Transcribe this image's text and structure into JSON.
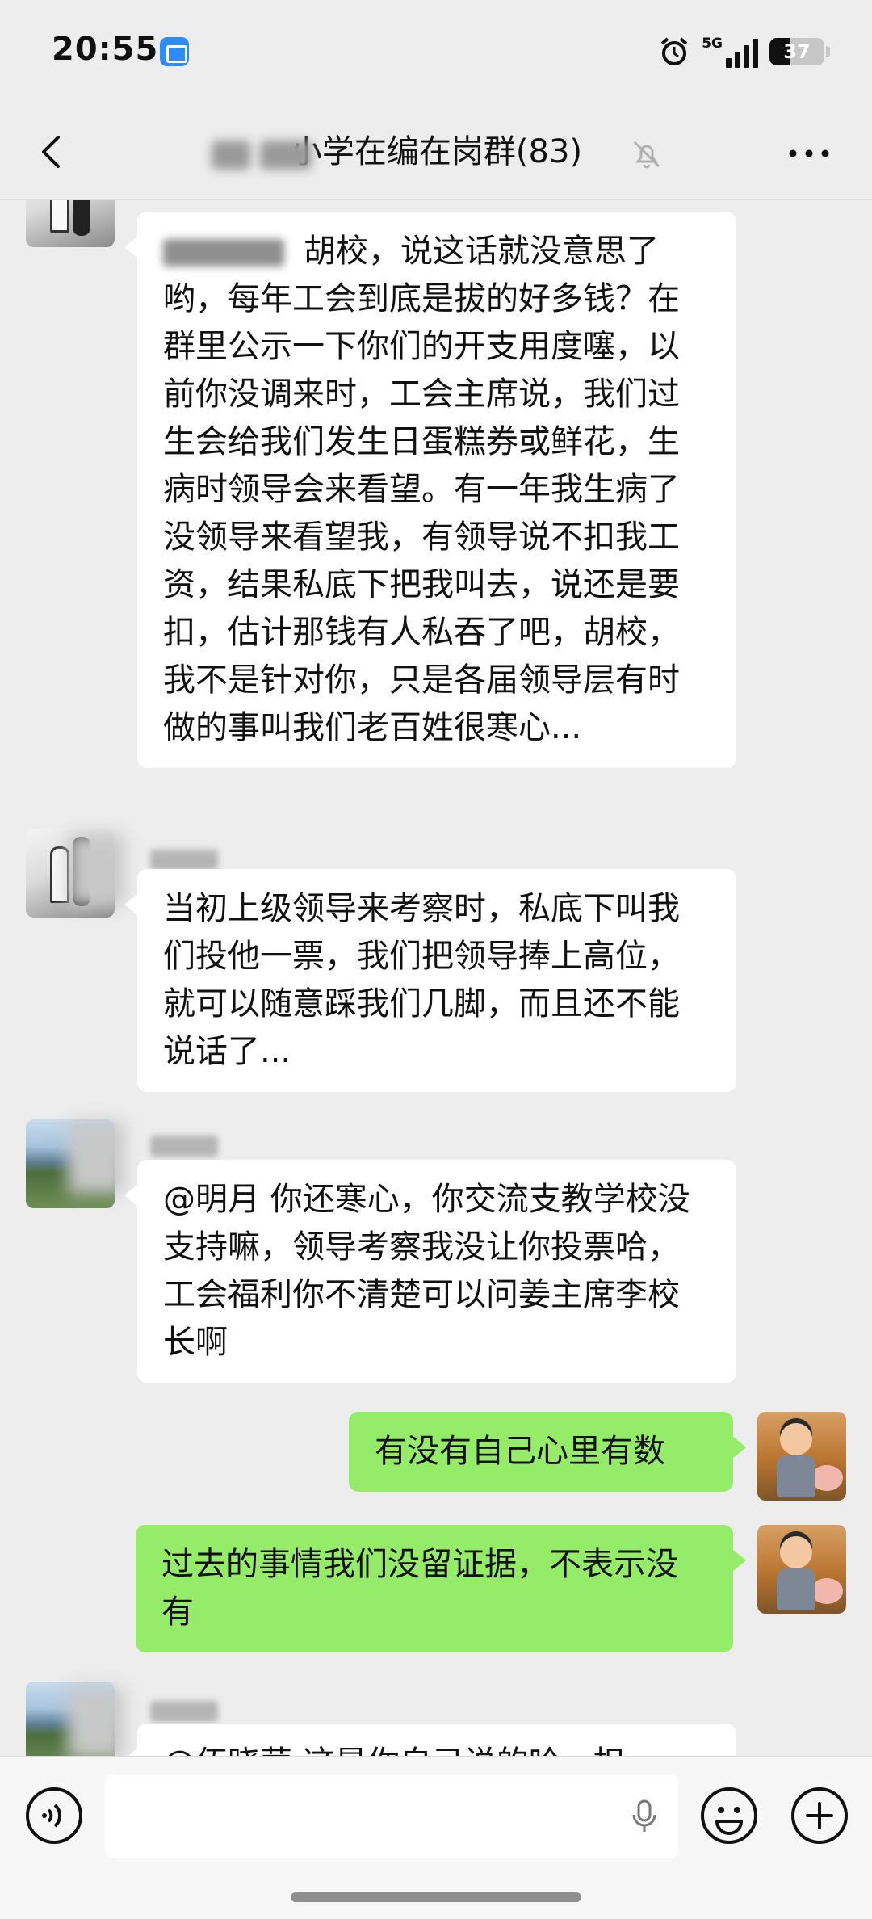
{
  "status_bar": {
    "time": "20:55",
    "network": "5G",
    "battery_level": "37",
    "battery_fraction": 0.37
  },
  "header": {
    "title": "小学在编在岗群(83)",
    "back_icon": "back-chevron-icon",
    "mute_icon": "bell-muted-icon",
    "more_icon": "more-dots-icon"
  },
  "messages": [
    {
      "direction": "in",
      "avatar": "street-photo-avatar",
      "text": "胡校，说这话就没意思了哟，每年工会到底是拔的好多钱？在群里公示一下你们的开支用度噻，以前你没调来时，工会主席说，我们过生会给我们发生日蛋糕券或鲜花，生病时领导会来看望。有一年我生病了没领导来看望我，有领导说不扣我工资，结果私底下把我叫去，说还是要扣，估计那钱有人私吞了吧，胡校，我不是针对你，只是各届领导层有时做的事叫我们老百姓很寒心..."
    },
    {
      "direction": "in",
      "avatar": "street-photo-avatar",
      "text": "当初上级领导来考察时，私底下叫我们投他一票，我们把领导捧上高位，就可以随意踩我们几脚，而且还不能说话了..."
    },
    {
      "direction": "in",
      "avatar": "seaside-photo-avatar",
      "text": "@明月  你还寒心，你交流支教学校没支持嘛，领导考察我没让你投票哈，工会福利你不清楚可以问姜主席李校长啊"
    },
    {
      "direction": "out",
      "avatar": "cartoon-boy-pig-avatar",
      "text": "有没有自己心里有数"
    },
    {
      "direction": "out",
      "avatar": "cartoon-boy-pig-avatar",
      "text": "过去的事情我们没留证据，不表示没有"
    },
    {
      "direction": "in",
      "avatar": "seaside-photo-avatar",
      "text": "@伍晓荣  这是你自己说的哈，担"
    }
  ],
  "input_bar": {
    "voice_icon": "voice-toggle-icon",
    "mic_icon": "microphone-icon",
    "emoji_icon": "emoji-icon",
    "plus_icon": "plus-icon"
  }
}
